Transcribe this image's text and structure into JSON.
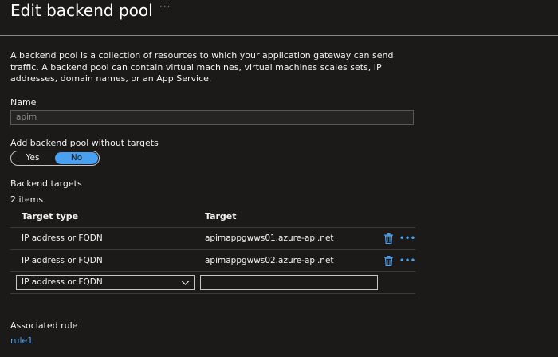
{
  "header": {
    "title": "Edit backend pool",
    "more": "···"
  },
  "description": "A backend pool is a collection of resources to which your application gateway can send traffic. A backend pool can contain virtual machines, virtual machines scales sets, IP addresses, domain names, or an App Service.",
  "name_field": {
    "label": "Name",
    "value": "apim"
  },
  "without_targets": {
    "label": "Add backend pool without targets",
    "options": [
      "Yes",
      "No"
    ],
    "selected": "No"
  },
  "backend_targets": {
    "label": "Backend targets",
    "count": "2 items",
    "columns": [
      "Target type",
      "Target"
    ],
    "rows": [
      {
        "type": "IP address or FQDN",
        "target": "apimappgwws01.azure-api.net"
      },
      {
        "type": "IP address or FQDN",
        "target": "apimappgwws02.azure-api.net"
      }
    ],
    "new_row": {
      "type_selected": "IP address or FQDN",
      "target_value": ""
    },
    "row_more": "•••"
  },
  "associated_rule": {
    "label": "Associated rule",
    "link": "rule1"
  },
  "colors": {
    "accent": "#4aa0f0",
    "background": "#1b1a19"
  },
  "icons": [
    "trash-icon",
    "more-icon",
    "chevron-down-icon"
  ]
}
